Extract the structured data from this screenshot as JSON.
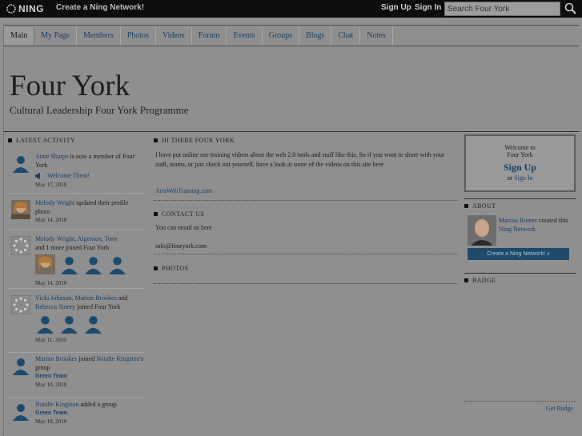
{
  "topbar": {
    "logo_text": "NING",
    "create_network": "Create a Ning Network!",
    "sign_up": "Sign Up",
    "sign_in": "Sign In",
    "search_placeholder": "Search Four York"
  },
  "nav": {
    "tabs": [
      {
        "label": "Main",
        "active": true
      },
      {
        "label": "My Page"
      },
      {
        "label": "Members"
      },
      {
        "label": "Photos"
      },
      {
        "label": "Videos"
      },
      {
        "label": "Forum"
      },
      {
        "label": "Events"
      },
      {
        "label": "Groups"
      },
      {
        "label": "Blogs"
      },
      {
        "label": "Chat"
      },
      {
        "label": "Notes"
      }
    ]
  },
  "header": {
    "title": "Four York",
    "tagline": "Cultural Leadership Four York Programme"
  },
  "activity": {
    "heading": "LATEST ACTIVITY",
    "items": [
      {
        "actor": "Anne Sharpe",
        "text": " is now a member of Four York",
        "extra": "Welcome Them!",
        "date": "May 17, 2010"
      },
      {
        "actor": "Melody Wright",
        "text": " updated their profile photo",
        "date": "May 14, 2010"
      },
      {
        "actor": "Melody Wright, Algernon, Tony",
        "text": " and 1 more joined Four York",
        "date": "May 14, 2010"
      },
      {
        "actor": "Vicki Johnson, Marion Brookes",
        "text": " and ",
        "actor2": "Rebecca Storey",
        "text2": " joined Four York",
        "date": "May 11, 2010"
      },
      {
        "actor": "Marion Brookes",
        "text": " joined ",
        "actor2": "Natalie Kingston",
        "text2": "'s group",
        "extra": "Green Team",
        "date": "May 10, 2010"
      },
      {
        "actor": "Natalie Kingston",
        "text": " added a group",
        "extra": "Green Team",
        "date": "May 10, 2010"
      }
    ]
  },
  "middle": {
    "hi_heading": "HI THERE FOUR YORK",
    "hi_body": "I have put online our training videos about the web 2.0 tools and stuff like this. So if you want to share with your staff, teams, or just check out yourself, have a look at some of the videos on this site here",
    "hi_link": "ArtsWebTraining.com",
    "contact_heading": "CONTACT US",
    "contact_line1": "You can email us here",
    "contact_line2": "info@fouryork.com",
    "photos_heading": "PHOTOS"
  },
  "right": {
    "welcome_line1": "Welcome to",
    "welcome_line2": "Four York",
    "sign_up": "Sign Up",
    "or": "or",
    "sign_in": "Sign In",
    "about_heading": "ABOUT",
    "about_name": "Marcus Romer",
    "about_text": " created this ",
    "about_link": "Ning Network.",
    "create_button": "Create a Ning Network! »",
    "badge_heading": "BADGE",
    "get_badge": "Get Badge"
  },
  "colors": {
    "link": "#163f66",
    "page_bg": "#8f8f8f",
    "button_bg": "#1f4a6b"
  }
}
